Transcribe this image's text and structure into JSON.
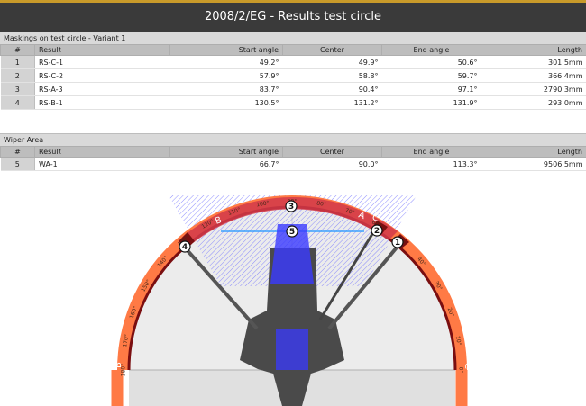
{
  "window": {
    "title": "2008/2/EG - Results test circle"
  },
  "maskings": {
    "section_title": "Maskings on test circle - Variant 1",
    "columns": [
      "#",
      "Result",
      "Start angle",
      "Center",
      "End angle",
      "Length"
    ],
    "rows": [
      {
        "idx": "1",
        "result": "RS-C-1",
        "start": "49.2°",
        "center": "49.9°",
        "end": "50.6°",
        "length": "301.5mm"
      },
      {
        "idx": "2",
        "result": "RS-C-2",
        "start": "57.9°",
        "center": "58.8°",
        "end": "59.7°",
        "length": "366.4mm"
      },
      {
        "idx": "3",
        "result": "RS-A-3",
        "start": "83.7°",
        "center": "90.4°",
        "end": "97.1°",
        "length": "2790.3mm"
      },
      {
        "idx": "4",
        "result": "RS-B-1",
        "start": "130.5°",
        "center": "131.2°",
        "end": "131.9°",
        "length": "293.0mm"
      }
    ]
  },
  "wiper": {
    "section_title": "Wiper Area",
    "columns": [
      "#",
      "Result",
      "Start angle",
      "Center",
      "End angle",
      "Length"
    ],
    "rows": [
      {
        "idx": "5",
        "result": "WA-1",
        "start": "66.7°",
        "center": "90.0°",
        "end": "113.3°",
        "length": "9506.5mm"
      }
    ]
  },
  "diagram": {
    "zone_letters": [
      "A",
      "B",
      "C"
    ],
    "ring_letters": [
      "B",
      "C"
    ],
    "degree_labels": [
      "0°",
      "10°",
      "20°",
      "30°",
      "40°",
      "50°",
      "60°",
      "70°",
      "80°",
      "90°",
      "100°",
      "110°",
      "120°",
      "130°",
      "140°",
      "150°",
      "160°",
      "170°",
      "180°"
    ],
    "markers": [
      "1",
      "2",
      "3",
      "4",
      "5"
    ],
    "colors": {
      "ring": "#ff7a45",
      "masking": "#d23a4a",
      "wiper": "#3a3aff",
      "dark_ring": "#7a0e10"
    }
  }
}
